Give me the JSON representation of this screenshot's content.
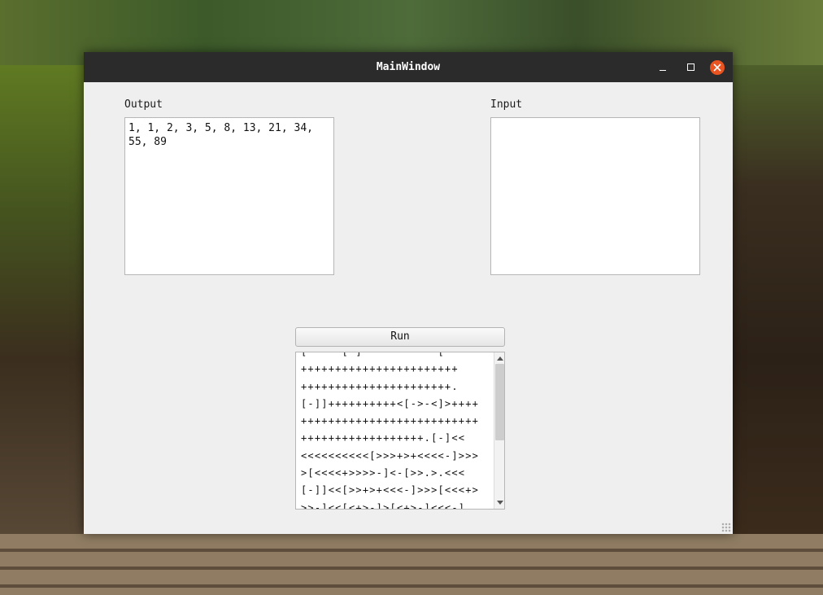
{
  "window": {
    "title": "MainWindow"
  },
  "labels": {
    "output": "Output",
    "input": "Input"
  },
  "output": {
    "value": "1, 1, 2, 3, 5, 8, 13, 21, 34,\n55, 89"
  },
  "input": {
    "value": ""
  },
  "run": {
    "label": "Run"
  },
  "code": {
    "lines": [
      "[-----[-]-----------[",
      "+++++++++++++++++++++++",
      "++++++++++++++++++++++.",
      "[-]]++++++++++<[->-<]>++++",
      "++++++++++++++++++++++++++",
      "++++++++++++++++++.[-]<<",
      "<<<<<<<<<<[>>>+>+<<<<-]>>>",
      ">[<<<<+>>>>-]<-[>>.>.<<<",
      "[-]]<<[>>+>+<<<-]>>>[<<<+>",
      ">>-]<<[<+>-]>[<+>-]<<<-]"
    ]
  },
  "icons": {
    "minimize": "minimize-icon",
    "maximize": "maximize-icon",
    "close": "close-icon"
  },
  "colors": {
    "titlebar": "#2b2b2b",
    "close_button": "#e95420",
    "window_bg": "#efefef"
  }
}
